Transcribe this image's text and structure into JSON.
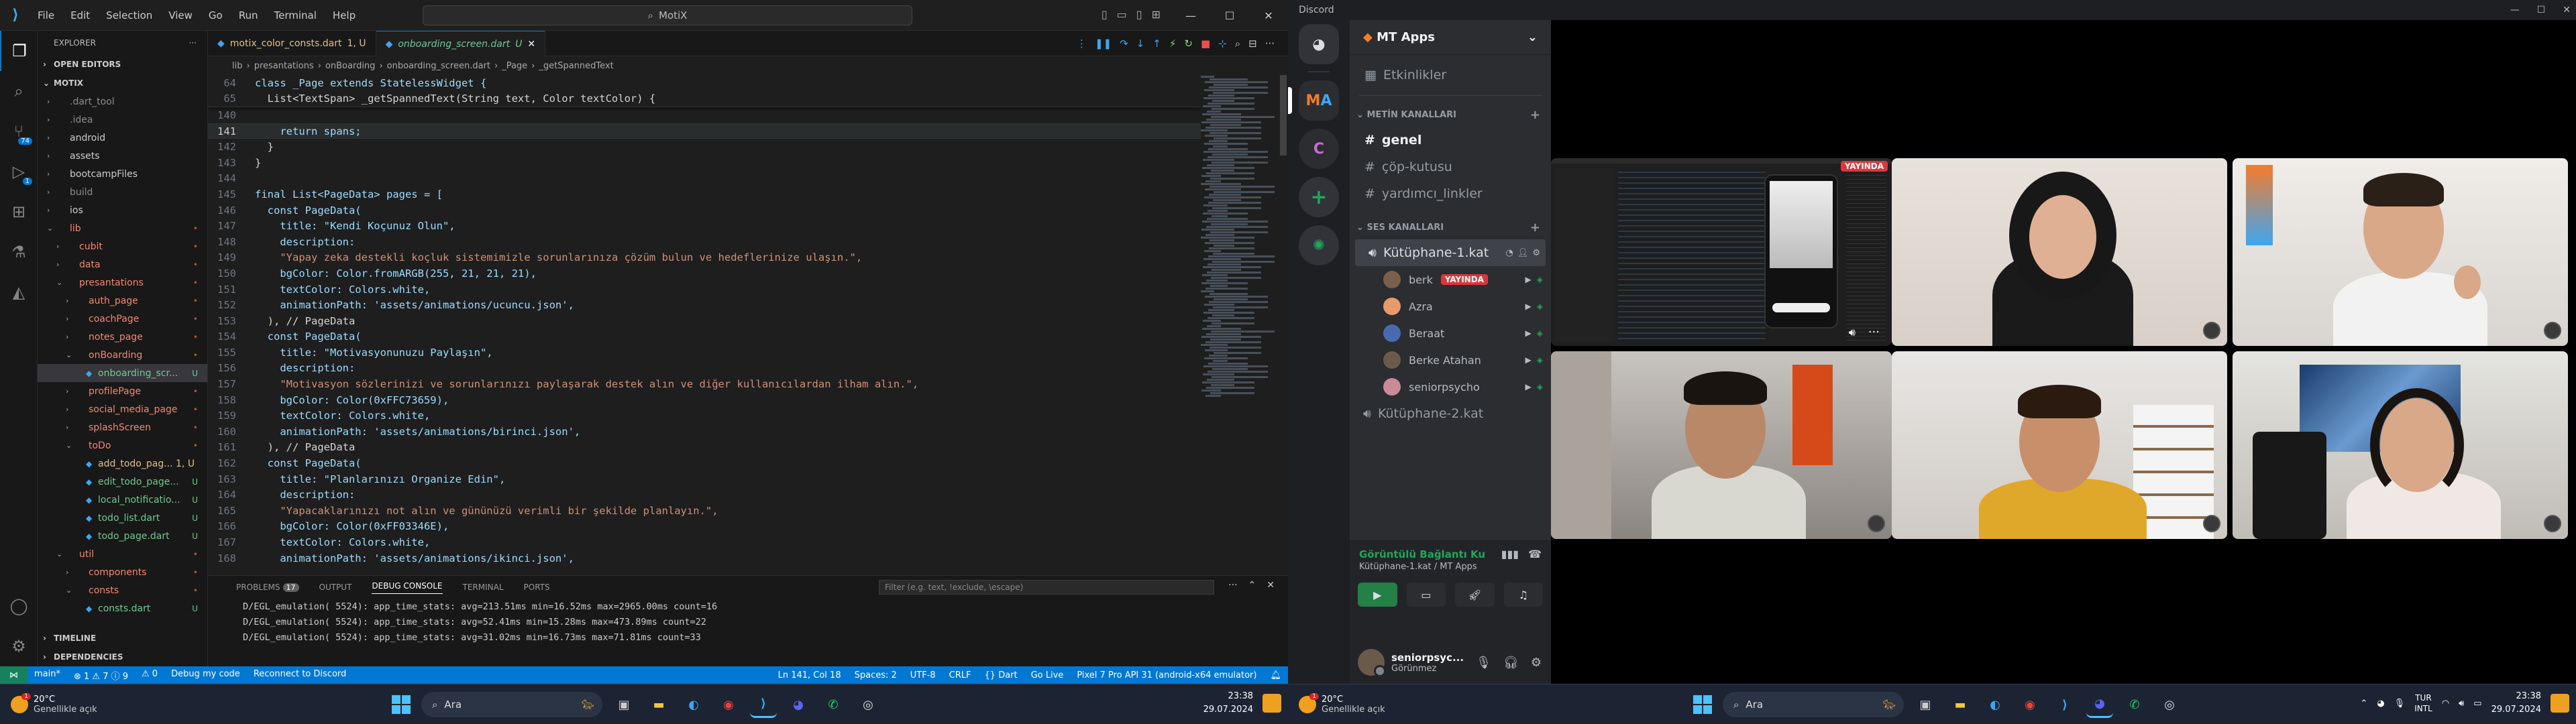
{
  "vscode": {
    "menu": [
      "File",
      "Edit",
      "Selection",
      "View",
      "Go",
      "Run",
      "Terminal",
      "Help"
    ],
    "search": "MotiX",
    "explorer_title": "EXPLORER",
    "open_editors": "OPEN EDITORS",
    "project": "MOTIX",
    "tree": [
      {
        "label": ".dart_tool",
        "depth": 1,
        "type": "folder",
        "status": ""
      },
      {
        "label": ".idea",
        "depth": 1,
        "type": "folder",
        "status": ""
      },
      {
        "label": "android",
        "depth": 1,
        "type": "folder",
        "status": ""
      },
      {
        "label": "assets",
        "depth": 1,
        "type": "folder",
        "status": ""
      },
      {
        "label": "bootcampFiles",
        "depth": 1,
        "type": "folder",
        "status": ""
      },
      {
        "label": "build",
        "depth": 1,
        "type": "folder",
        "status": ""
      },
      {
        "label": "ios",
        "depth": 1,
        "type": "folder",
        "status": ""
      },
      {
        "label": "lib",
        "depth": 1,
        "type": "folder-open",
        "status": "•"
      },
      {
        "label": "cubit",
        "depth": 2,
        "type": "folder",
        "status": "•"
      },
      {
        "label": "data",
        "depth": 2,
        "type": "folder",
        "status": "•"
      },
      {
        "label": "presantations",
        "depth": 2,
        "type": "folder-open",
        "status": "•"
      },
      {
        "label": "auth_page",
        "depth": 3,
        "type": "folder",
        "status": "•"
      },
      {
        "label": "coachPage",
        "depth": 3,
        "type": "folder",
        "status": "•"
      },
      {
        "label": "notes_page",
        "depth": 3,
        "type": "folder",
        "status": "•"
      },
      {
        "label": "onBoarding",
        "depth": 3,
        "type": "folder-open",
        "status": "•"
      },
      {
        "label": "onboarding_scr...",
        "depth": 4,
        "type": "file",
        "status": "U"
      },
      {
        "label": "profilePage",
        "depth": 3,
        "type": "folder",
        "status": "•"
      },
      {
        "label": "social_media_page",
        "depth": 3,
        "type": "folder",
        "status": "•"
      },
      {
        "label": "splashScreen",
        "depth": 3,
        "type": "folder",
        "status": "•"
      },
      {
        "label": "toDo",
        "depth": 3,
        "type": "folder-open",
        "status": "•"
      },
      {
        "label": "add_todo_pag... 1, U",
        "depth": 4,
        "type": "file",
        "status": ""
      },
      {
        "label": "edit_todo_page...",
        "depth": 4,
        "type": "file",
        "status": "U"
      },
      {
        "label": "local_notificatio...",
        "depth": 4,
        "type": "file",
        "status": "U"
      },
      {
        "label": "todo_list.dart",
        "depth": 4,
        "type": "file",
        "status": "U"
      },
      {
        "label": "todo_page.dart",
        "depth": 4,
        "type": "file",
        "status": "U"
      },
      {
        "label": "util",
        "depth": 2,
        "type": "folder-open",
        "status": "•"
      },
      {
        "label": "components",
        "depth": 3,
        "type": "folder",
        "status": "•"
      },
      {
        "label": "consts",
        "depth": 3,
        "type": "folder-open",
        "status": "•"
      },
      {
        "label": "consts.dart",
        "depth": 4,
        "type": "file",
        "status": "U"
      }
    ],
    "timeline": "TIMELINE",
    "dependencies": "DEPENDENCIES",
    "tabs": [
      {
        "label": "motix_color_consts.dart",
        "status": "1, U"
      },
      {
        "label": "onboarding_screen.dart",
        "status": "U"
      }
    ],
    "breadcrumb": [
      "lib",
      "presantations",
      "onBoarding",
      "onboarding_screen.dart",
      "_Page",
      "_getSpannedText"
    ],
    "sticky_lines": [
      {
        "num": "64",
        "code": "class _Page extends StatelessWidget {"
      },
      {
        "num": "65",
        "code": "  List<TextSpan> _getSpannedText(String text, Color textColor) {"
      }
    ],
    "code_lines": [
      {
        "num": "140",
        "code": ""
      },
      {
        "num": "141",
        "code": "    return spans;"
      },
      {
        "num": "142",
        "code": "  }"
      },
      {
        "num": "143",
        "code": "}"
      },
      {
        "num": "144",
        "code": ""
      },
      {
        "num": "145",
        "code": "final List<PageData> pages = ["
      },
      {
        "num": "146",
        "code": "  const PageData("
      },
      {
        "num": "147",
        "code": "    title: \"Kendi Koçunuz Olun\","
      },
      {
        "num": "148",
        "code": "    description:"
      },
      {
        "num": "149",
        "code": "    \"Yapay zeka destekli koçluk sistemimizle sorunlarınıza çözüm bulun ve hedeflerinize ulaşın.\","
      },
      {
        "num": "150",
        "code": "    bgColor: Color.fromARGB(255, 21, 21, 21),"
      },
      {
        "num": "151",
        "code": "    textColor: Colors.white,"
      },
      {
        "num": "152",
        "code": "    animationPath: 'assets/animations/ucuncu.json',"
      },
      {
        "num": "153",
        "code": "  ), // PageData"
      },
      {
        "num": "154",
        "code": "  const PageData("
      },
      {
        "num": "155",
        "code": "    title: \"Motivasyonunuzu Paylaşın\","
      },
      {
        "num": "156",
        "code": "    description:"
      },
      {
        "num": "157",
        "code": "    \"Motivasyon sözlerinizi ve sorunlarınızı paylaşarak destek alın ve diğer kullanıcılardan ilham alın.\","
      },
      {
        "num": "158",
        "code": "    bgColor: Color(0xFFC73659),"
      },
      {
        "num": "159",
        "code": "    textColor: Colors.white,"
      },
      {
        "num": "160",
        "code": "    animationPath: 'assets/animations/birinci.json',"
      },
      {
        "num": "161",
        "code": "  ), // PageData"
      },
      {
        "num": "162",
        "code": "  const PageData("
      },
      {
        "num": "163",
        "code": "    title: \"Planlarınızı Organize Edin\","
      },
      {
        "num": "164",
        "code": "    description:"
      },
      {
        "num": "165",
        "code": "    \"Yapacaklarınızı not alın ve gününüzü verimli bir şekilde planlayın.\","
      },
      {
        "num": "166",
        "code": "    bgColor: Color(0xFF03346E),"
      },
      {
        "num": "167",
        "code": "    textColor: Colors.white,"
      },
      {
        "num": "168",
        "code": "    animationPath: 'assets/animations/ikinci.json',"
      }
    ],
    "panel_tabs": {
      "problems": "PROBLEMS",
      "problems_count": "17",
      "output": "OUTPUT",
      "debug": "DEBUG CONSOLE",
      "terminal": "TERMINAL",
      "ports": "PORTS"
    },
    "panel_filter_placeholder": "Filter (e.g. text, !exclude, \\escape)",
    "log_lines": [
      "D/EGL_emulation( 5524): app_time_stats: avg=213.51ms min=16.52ms max=2965.00ms count=16",
      "D/EGL_emulation( 5524): app_time_stats: avg=52.41ms min=15.28ms max=473.89ms count=22",
      "D/EGL_emulation( 5524): app_time_stats: avg=31.02ms min=16.73ms max=71.81ms count=33"
    ],
    "status_left": [
      "main*",
      "⊗ 1 ⚠ 7 ⓘ 9",
      "⚠ 0",
      "Debug my code",
      "Reconnect to Discord"
    ],
    "status_right": [
      "Ln 141, Col 18",
      "Spaces: 2",
      "UTF-8",
      "CRLF",
      "{} Dart",
      "Go Live",
      "Pixel 7 Pro API 31 (android-x64 emulator)"
    ]
  },
  "taskbar_left": {
    "temp": "20°C",
    "weather": "Genellikle açık",
    "search": "Ara",
    "time": "23:38",
    "date": "29.07.2024",
    "badge": "1"
  },
  "taskbar_right": {
    "temp": "20°C",
    "weather": "Genellikle açık",
    "search": "Ara",
    "lang": "TUR",
    "lang2": "INTL",
    "time": "23:38",
    "date": "29.07.2024",
    "badge": "1"
  },
  "discord": {
    "title": "Discord",
    "server": "MT Apps",
    "events": "Etkinlikler",
    "text_category": "METİN KANALLARI",
    "text_channels": [
      "genel",
      "çöp-kutusu",
      "yardımcı_linkler"
    ],
    "voice_category": "SES KANALLARI",
    "voice_channel_1": "Kütüphane-1.kat",
    "voice_channel_2": "Kütüphane-2.kat",
    "voice_users": [
      {
        "name": "berk",
        "live": "YAYINDA",
        "color": "#7a5f4a"
      },
      {
        "name": "Azra",
        "live": "",
        "color": "#e89a6a"
      },
      {
        "name": "Beraat",
        "live": "",
        "color": "#4a6ab0"
      },
      {
        "name": "Berke Atahan",
        "live": "",
        "color": "#6a5a4a"
      },
      {
        "name": "seniorpsycho",
        "live": "",
        "color": "#c98a9a"
      }
    ],
    "connection_status": "Görüntülü Bağlantı Ku",
    "connection_sub": "Kütüphane-1.kat / MT Apps",
    "user_name": "seniorpsyc...",
    "user_status": "Görünmez",
    "stream_badge": "YAYINDA"
  }
}
